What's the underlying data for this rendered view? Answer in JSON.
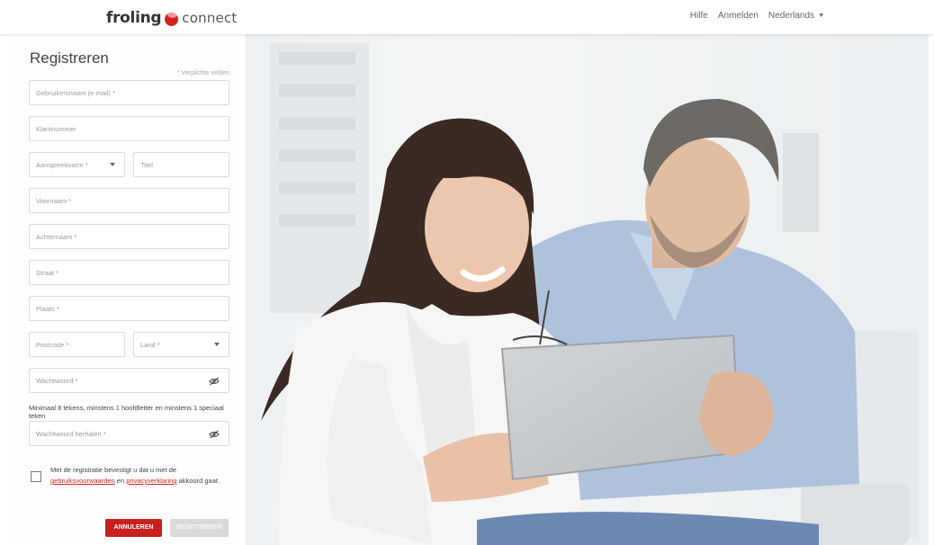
{
  "header": {
    "logo_word": "froling",
    "logo_connect": "connect",
    "nav": {
      "help": "Hilfe",
      "login": "Anmelden",
      "language": "Nederlands"
    }
  },
  "form": {
    "title": "Registreren",
    "required_note": "* Verplichte velden",
    "fields": {
      "username": "Gebruikersnaam (e-mail) *",
      "customer_number": "Klantnummer",
      "salutation": "Aanspreekvorm *",
      "title": "Titel",
      "first_name": "Voornaam *",
      "last_name": "Achternaam *",
      "street": "Straat *",
      "city": "Plaats *",
      "postcode": "Postcode *",
      "country": "Land *",
      "password": "Wachtwoord *",
      "password_repeat": "Wachtwoord herhalen *"
    },
    "password_hint": "Minimaal 8 tekens, minstens 1 hoofdletter en minstens 1 speciaal teken",
    "terms": {
      "part1": "Met de registratie bevestigt u dat u met de",
      "link1": "gebruiksvoorwaarden",
      "part2": " en ",
      "link2": "privacyverklaring",
      "part3": " akkoord gaat."
    },
    "buttons": {
      "cancel": "ANNULEREN",
      "register": "REGISTREREN"
    }
  },
  "colors": {
    "brand_red": "#d7231e",
    "button_red": "#c8201e",
    "disabled": "#d9d9d9"
  },
  "icons": [
    "froling-logo-dot-icon",
    "chevron-down-icon",
    "eye-off-icon"
  ]
}
